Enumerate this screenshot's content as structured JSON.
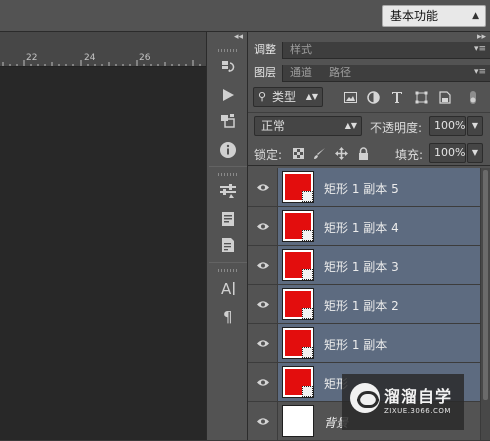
{
  "topbar": {
    "workspace": "基本功能"
  },
  "ruler": {
    "numbers": [
      "22",
      "24",
      "26"
    ]
  },
  "panel_tabs_top": [
    "调整",
    "样式"
  ],
  "panel_tabs_layers": [
    "图层",
    "通道",
    "路径"
  ],
  "filter": {
    "kind": "类型"
  },
  "blend": {
    "mode": "正常",
    "opacity_label": "不透明度:",
    "opacity": "100%"
  },
  "lock": {
    "label": "锁定:",
    "fill_label": "填充:",
    "fill": "100%"
  },
  "layers": [
    {
      "name": "矩形 1 副本 5"
    },
    {
      "name": "矩形 1 副本 4"
    },
    {
      "name": "矩形 1 副本 3"
    },
    {
      "name": "矩形 1 副本 2"
    },
    {
      "name": "矩形 1 副本"
    },
    {
      "name": "矩形"
    },
    {
      "name": "背景"
    }
  ],
  "watermark": {
    "title": "溜溜自学",
    "url": "ZIXUE.3066.COM"
  },
  "icons": {
    "toolstrip": [
      "history-icon",
      "play-icon",
      "properties-icon",
      "info-icon",
      "brush-settings-icon",
      "clone-source-icon",
      "notes-icon",
      "character-icon",
      "paragraph-icon"
    ],
    "filter": [
      "image-filter-icon",
      "adjustment-filter-icon",
      "type-filter-icon",
      "shape-filter-icon",
      "smart-object-filter-icon"
    ],
    "lock": [
      "lock-transparent-icon",
      "lock-paint-icon",
      "lock-position-icon",
      "lock-all-icon"
    ]
  },
  "colors": {
    "layer_fill": "#e30d0d",
    "selection": "#5d6b80"
  }
}
